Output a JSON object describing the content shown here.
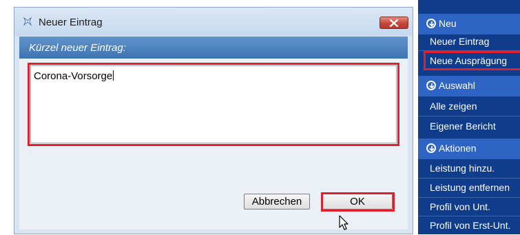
{
  "dialog": {
    "title": "Neuer Eintrag",
    "header_label": "Kürzel neuer Eintrag:",
    "input_value": "Corona-Vorsorge",
    "cancel_label": "Abbrechen",
    "ok_label": "OK"
  },
  "panel": {
    "sections": [
      {
        "header": "Neu",
        "items": [
          "Neuer Eintrag",
          "Neue Ausprägung"
        ]
      },
      {
        "header": "Auswahl",
        "items": [
          "Alle zeigen",
          "Eigener Bericht"
        ]
      },
      {
        "header": "Aktionen",
        "items": [
          "Leistung hinzu.",
          "Leistung entfernen",
          "Profil von Unt.",
          "Profil von Erst-Unt."
        ]
      }
    ]
  },
  "colors": {
    "accent": "#2e65c4",
    "panel_bg": "#0f3c8b",
    "highlight": "#e0202c"
  },
  "icons": [
    "app-icon",
    "close-icon",
    "circle-arrow-down-icon",
    "mouse-pointer-icon"
  ]
}
